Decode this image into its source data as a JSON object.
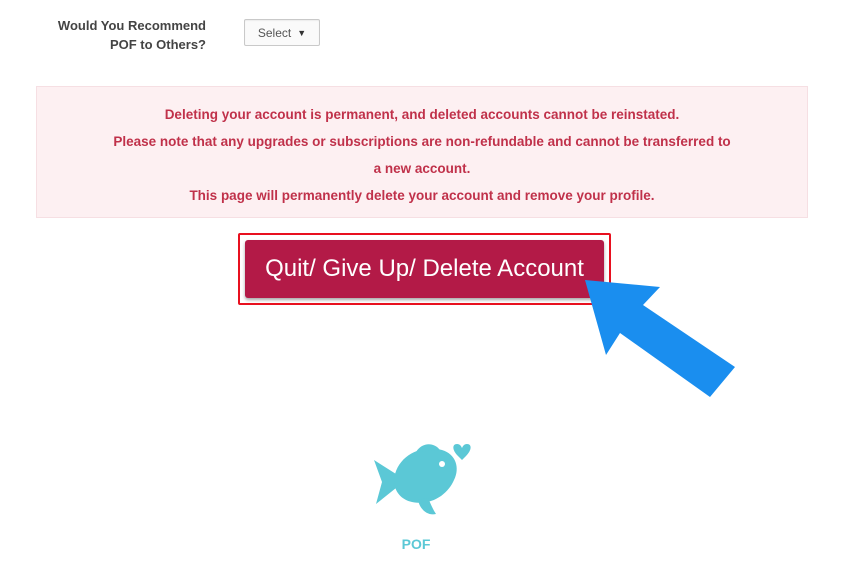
{
  "recommend": {
    "label_line1": "Would You Recommend",
    "label_line2": "POF to Others?",
    "select_value": "Select"
  },
  "warning": {
    "line1": "Deleting your account is permanent, and deleted accounts cannot be reinstated.",
    "line2": "Please note that any upgrades or subscriptions are non-refundable and cannot be transferred to",
    "line3": "a new account.",
    "line4": "This page will permanently delete your account and remove your profile."
  },
  "delete_button": {
    "label": "Quit/ Give Up/ Delete Account"
  },
  "logo": {
    "text": "POF",
    "icon": "fish-heart-icon"
  },
  "annotation": {
    "icon": "arrow-pointer-icon"
  },
  "colors": {
    "button": "#b31a47",
    "highlight_outline": "#e8101f",
    "warning_bg": "#fdf0f2",
    "warning_text": "#c0314a",
    "arrow": "#1a8eef",
    "logo": "#5bc8d6"
  }
}
